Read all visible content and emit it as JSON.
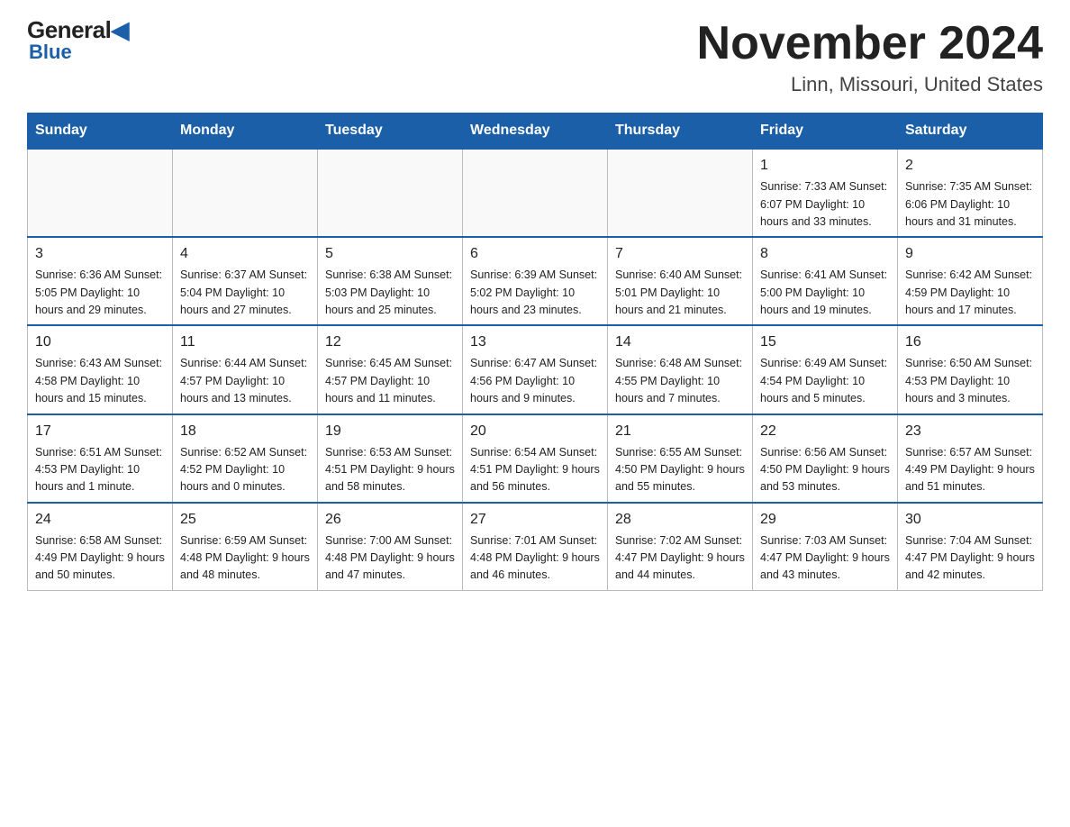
{
  "header": {
    "logo_top": "General",
    "logo_blue": "Blue",
    "month_year": "November 2024",
    "location": "Linn, Missouri, United States"
  },
  "days_of_week": [
    "Sunday",
    "Monday",
    "Tuesday",
    "Wednesday",
    "Thursday",
    "Friday",
    "Saturday"
  ],
  "weeks": [
    [
      {
        "day": "",
        "info": ""
      },
      {
        "day": "",
        "info": ""
      },
      {
        "day": "",
        "info": ""
      },
      {
        "day": "",
        "info": ""
      },
      {
        "day": "",
        "info": ""
      },
      {
        "day": "1",
        "info": "Sunrise: 7:33 AM\nSunset: 6:07 PM\nDaylight: 10 hours and 33 minutes."
      },
      {
        "day": "2",
        "info": "Sunrise: 7:35 AM\nSunset: 6:06 PM\nDaylight: 10 hours and 31 minutes."
      }
    ],
    [
      {
        "day": "3",
        "info": "Sunrise: 6:36 AM\nSunset: 5:05 PM\nDaylight: 10 hours and 29 minutes."
      },
      {
        "day": "4",
        "info": "Sunrise: 6:37 AM\nSunset: 5:04 PM\nDaylight: 10 hours and 27 minutes."
      },
      {
        "day": "5",
        "info": "Sunrise: 6:38 AM\nSunset: 5:03 PM\nDaylight: 10 hours and 25 minutes."
      },
      {
        "day": "6",
        "info": "Sunrise: 6:39 AM\nSunset: 5:02 PM\nDaylight: 10 hours and 23 minutes."
      },
      {
        "day": "7",
        "info": "Sunrise: 6:40 AM\nSunset: 5:01 PM\nDaylight: 10 hours and 21 minutes."
      },
      {
        "day": "8",
        "info": "Sunrise: 6:41 AM\nSunset: 5:00 PM\nDaylight: 10 hours and 19 minutes."
      },
      {
        "day": "9",
        "info": "Sunrise: 6:42 AM\nSunset: 4:59 PM\nDaylight: 10 hours and 17 minutes."
      }
    ],
    [
      {
        "day": "10",
        "info": "Sunrise: 6:43 AM\nSunset: 4:58 PM\nDaylight: 10 hours and 15 minutes."
      },
      {
        "day": "11",
        "info": "Sunrise: 6:44 AM\nSunset: 4:57 PM\nDaylight: 10 hours and 13 minutes."
      },
      {
        "day": "12",
        "info": "Sunrise: 6:45 AM\nSunset: 4:57 PM\nDaylight: 10 hours and 11 minutes."
      },
      {
        "day": "13",
        "info": "Sunrise: 6:47 AM\nSunset: 4:56 PM\nDaylight: 10 hours and 9 minutes."
      },
      {
        "day": "14",
        "info": "Sunrise: 6:48 AM\nSunset: 4:55 PM\nDaylight: 10 hours and 7 minutes."
      },
      {
        "day": "15",
        "info": "Sunrise: 6:49 AM\nSunset: 4:54 PM\nDaylight: 10 hours and 5 minutes."
      },
      {
        "day": "16",
        "info": "Sunrise: 6:50 AM\nSunset: 4:53 PM\nDaylight: 10 hours and 3 minutes."
      }
    ],
    [
      {
        "day": "17",
        "info": "Sunrise: 6:51 AM\nSunset: 4:53 PM\nDaylight: 10 hours and 1 minute."
      },
      {
        "day": "18",
        "info": "Sunrise: 6:52 AM\nSunset: 4:52 PM\nDaylight: 10 hours and 0 minutes."
      },
      {
        "day": "19",
        "info": "Sunrise: 6:53 AM\nSunset: 4:51 PM\nDaylight: 9 hours and 58 minutes."
      },
      {
        "day": "20",
        "info": "Sunrise: 6:54 AM\nSunset: 4:51 PM\nDaylight: 9 hours and 56 minutes."
      },
      {
        "day": "21",
        "info": "Sunrise: 6:55 AM\nSunset: 4:50 PM\nDaylight: 9 hours and 55 minutes."
      },
      {
        "day": "22",
        "info": "Sunrise: 6:56 AM\nSunset: 4:50 PM\nDaylight: 9 hours and 53 minutes."
      },
      {
        "day": "23",
        "info": "Sunrise: 6:57 AM\nSunset: 4:49 PM\nDaylight: 9 hours and 51 minutes."
      }
    ],
    [
      {
        "day": "24",
        "info": "Sunrise: 6:58 AM\nSunset: 4:49 PM\nDaylight: 9 hours and 50 minutes."
      },
      {
        "day": "25",
        "info": "Sunrise: 6:59 AM\nSunset: 4:48 PM\nDaylight: 9 hours and 48 minutes."
      },
      {
        "day": "26",
        "info": "Sunrise: 7:00 AM\nSunset: 4:48 PM\nDaylight: 9 hours and 47 minutes."
      },
      {
        "day": "27",
        "info": "Sunrise: 7:01 AM\nSunset: 4:48 PM\nDaylight: 9 hours and 46 minutes."
      },
      {
        "day": "28",
        "info": "Sunrise: 7:02 AM\nSunset: 4:47 PM\nDaylight: 9 hours and 44 minutes."
      },
      {
        "day": "29",
        "info": "Sunrise: 7:03 AM\nSunset: 4:47 PM\nDaylight: 9 hours and 43 minutes."
      },
      {
        "day": "30",
        "info": "Sunrise: 7:04 AM\nSunset: 4:47 PM\nDaylight: 9 hours and 42 minutes."
      }
    ]
  ]
}
